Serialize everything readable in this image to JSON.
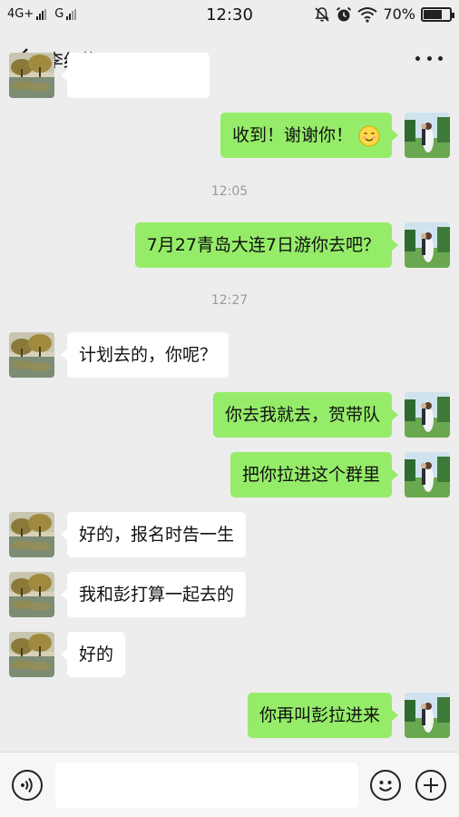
{
  "status": {
    "network1": "4G+",
    "network2": "G",
    "time": "12:30",
    "battery": "70%",
    "battery_level": 0.7
  },
  "header": {
    "title": "李红梅",
    "back_icon": "chevron-left-icon",
    "more_icon": "more-dots-icon"
  },
  "messages": [
    {
      "side": "in",
      "text": ""
    },
    {
      "side": "out",
      "text": "收到！谢谢你！",
      "emoji": "smiling-face-emoji"
    },
    {
      "type": "time",
      "text": "12:05"
    },
    {
      "side": "out",
      "text": "7月27青岛大连7日游你去吧？"
    },
    {
      "type": "time",
      "text": "12:27"
    },
    {
      "side": "in",
      "text": "计划去的，你呢？"
    },
    {
      "side": "out",
      "text": "你去我就去，贺带队"
    },
    {
      "side": "out",
      "text": "把你拉进这个群里"
    },
    {
      "side": "in",
      "text": "好的，报名时告一生"
    },
    {
      "side": "in",
      "text": "我和彭打算一起去的"
    },
    {
      "side": "in",
      "text": "好的"
    },
    {
      "side": "out",
      "text": "你再叫彭拉进来"
    }
  ],
  "input": {
    "placeholder": "",
    "voice_icon": "voice-icon",
    "emoji_icon": "emoji-icon",
    "plus_icon": "plus-icon"
  },
  "colors": {
    "outgoing_bubble": "#95ec69",
    "incoming_bubble": "#ffffff",
    "background": "#ededed"
  }
}
